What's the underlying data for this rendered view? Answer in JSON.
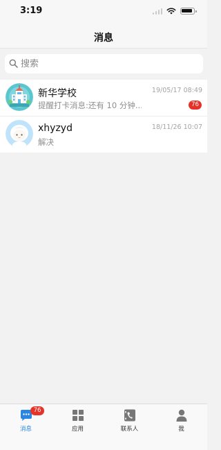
{
  "status_bar": {
    "time": "3:19"
  },
  "nav": {
    "title": "消息"
  },
  "search": {
    "placeholder": "搜索"
  },
  "chats": [
    {
      "name": "新华学校",
      "preview": "提醒打卡消息:还有 10 分钟...",
      "time": "19/05/17 08:49",
      "unread": "76",
      "avatar_icon": "school-building-icon"
    },
    {
      "name": "xhyzyd",
      "preview": "解决",
      "time": "18/11/26 10:07",
      "avatar_icon": "user-face-icon"
    }
  ],
  "tabs": [
    {
      "label": "消息",
      "icon": "chat-bubble-icon",
      "active": true,
      "badge": "76"
    },
    {
      "label": "应用",
      "icon": "apps-grid-icon",
      "active": false
    },
    {
      "label": "联系人",
      "icon": "contacts-phone-icon",
      "active": false
    },
    {
      "label": "我",
      "icon": "person-icon",
      "active": false
    }
  ],
  "colors": {
    "accent": "#2a86e0",
    "badge": "#e6332a",
    "background": "#f2f2f2"
  }
}
